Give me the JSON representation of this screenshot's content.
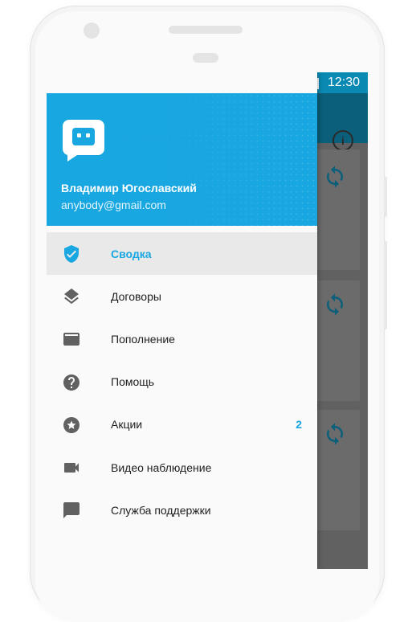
{
  "status_bar": {
    "time": "12:30",
    "icons": [
      "wifi-icon",
      "signal-icon",
      "battery-icon"
    ]
  },
  "background_app": {
    "toolbar_icon": "info-icon",
    "card_icon": "sync-icon"
  },
  "drawer": {
    "logo_icon": "chat-bot-icon",
    "user": {
      "name": "Владимир Югославский",
      "email": "anybody@gmail.com"
    },
    "items": [
      {
        "label": "Сводка",
        "icon": "shield-check-icon",
        "active": true
      },
      {
        "label": "Договоры",
        "icon": "layers-icon"
      },
      {
        "label": "Пополнение",
        "icon": "credit-card-icon"
      },
      {
        "label": "Помощь",
        "icon": "help-circle-icon"
      },
      {
        "label": "Акции",
        "icon": "star-circle-icon",
        "badge": "2"
      },
      {
        "label": "Видео наблюдение",
        "icon": "videocam-icon"
      },
      {
        "label": "Служба поддержки",
        "icon": "chat-icon"
      }
    ]
  },
  "colors": {
    "accent": "#18a7e1",
    "status_bar": "#0a8ab3",
    "icon_gray": "#616161",
    "scrim": "#616161"
  }
}
